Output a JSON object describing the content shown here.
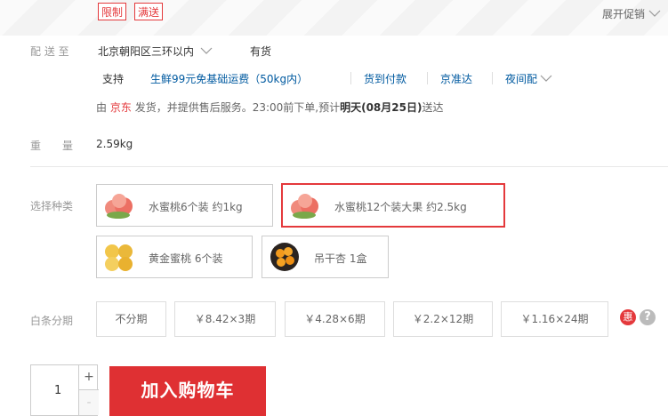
{
  "promo": {
    "tags": [
      "限制",
      "满送"
    ],
    "expand_label": "展开促销",
    "chevron": "chevron-down-icon"
  },
  "delivery": {
    "label": "配 送 至",
    "location": "北京朝阳区三环以内",
    "stock": "有货",
    "support_label": "支持",
    "services": [
      "生鲜99元免基础运费（50kg内）",
      "货到付款",
      "京准达",
      "夜间配"
    ],
    "ship_prefix": "由",
    "seller": "京东",
    "ship_middle": "发货，并提供售后服务。23:00前下单,预计",
    "ship_date": "明天(08月25日)",
    "ship_suffix": "送达"
  },
  "weight": {
    "label": "重　　量",
    "value": "2.59kg"
  },
  "variants": {
    "label": "选择种类",
    "items": [
      {
        "label": "水蜜桃6个装 约1kg",
        "selected": false,
        "fruit": "peach"
      },
      {
        "label": "水蜜桃12个装大果 约2.5kg",
        "selected": true,
        "fruit": "peach"
      },
      {
        "label": "黄金蜜桃 6个装",
        "selected": false,
        "fruit": "yellow-peach"
      },
      {
        "label": "吊干杏 1盒",
        "selected": false,
        "fruit": "apricot"
      }
    ]
  },
  "baitiao": {
    "label": "白条分期",
    "plans": [
      "不分期",
      "￥8.42×3期",
      "￥4.28×6期",
      "￥2.2×12期",
      "￥1.16×24期"
    ],
    "badge": "惠",
    "help": "?"
  },
  "cart": {
    "quantity": "1",
    "plus": "+",
    "minus": "-",
    "add_label": "加入购物车"
  },
  "colors": {
    "accent": "#e4393c",
    "link": "#005aa0",
    "cart_button": "#df3033"
  }
}
